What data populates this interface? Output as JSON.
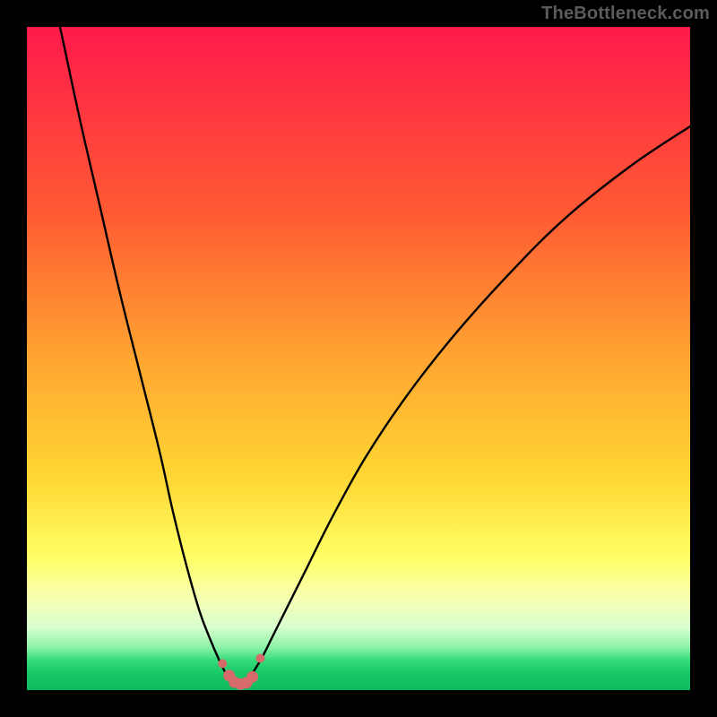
{
  "watermark": {
    "text": "TheBottleneck.com"
  },
  "colors": {
    "frame": "#000000",
    "curve": "#000000",
    "marker": "#d76a6a",
    "gradient_stops": [
      {
        "offset": 0.0,
        "color": "#ff1a4b"
      },
      {
        "offset": 0.28,
        "color": "#ff5a33"
      },
      {
        "offset": 0.5,
        "color": "#ffa531"
      },
      {
        "offset": 0.68,
        "color": "#ffd733"
      },
      {
        "offset": 0.8,
        "color": "#ffff66"
      },
      {
        "offset": 0.86,
        "color": "#f7ffb0"
      },
      {
        "offset": 0.905,
        "color": "#d8ffcf"
      },
      {
        "offset": 0.935,
        "color": "#8ef2a8"
      },
      {
        "offset": 0.955,
        "color": "#34dd7a"
      },
      {
        "offset": 0.975,
        "color": "#18c766"
      },
      {
        "offset": 1.0,
        "color": "#10b85d"
      }
    ]
  },
  "chart_data": {
    "type": "line",
    "title": "",
    "xlabel": "",
    "ylabel": "",
    "xlim": [
      0,
      100
    ],
    "ylim": [
      0,
      100
    ],
    "grid": false,
    "series": [
      {
        "name": "left-branch",
        "x": [
          5,
          8,
          11,
          14,
          17,
          20,
          22,
          24,
          26,
          27.5,
          29,
          30
        ],
        "y": [
          100,
          86,
          73,
          60,
          48,
          36,
          27,
          19,
          12,
          8,
          4.5,
          2.5
        ]
      },
      {
        "name": "right-branch",
        "x": [
          34,
          35.5,
          37,
          39,
          42,
          46,
          51,
          57,
          64,
          72,
          81,
          91,
          100
        ],
        "y": [
          2.5,
          5,
          8,
          12,
          18,
          26,
          35,
          44,
          53,
          62,
          71,
          79,
          85
        ]
      },
      {
        "name": "valley",
        "x": [
          30,
          30.8,
          31.6,
          32.4,
          33.2,
          34
        ],
        "y": [
          2.5,
          1.2,
          0.6,
          0.6,
          1.2,
          2.5
        ]
      }
    ],
    "markers": {
      "name": "valley-points",
      "x": [
        29.5,
        30.5,
        31.3,
        32.2,
        33.1,
        34.0,
        35.2
      ],
      "y": [
        4.0,
        2.2,
        1.2,
        0.9,
        1.1,
        2.0,
        4.8
      ]
    }
  }
}
